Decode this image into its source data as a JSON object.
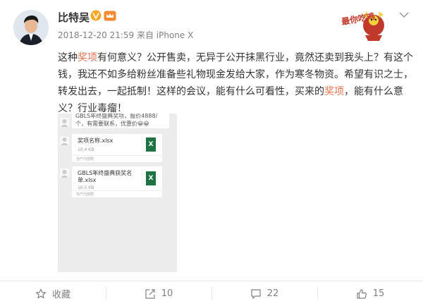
{
  "post": {
    "username": "比特吴",
    "meta": "2018-12-20 21:59 来自 iPhone X",
    "sticker_text": "最你吃鸡",
    "text": {
      "p1": "这种",
      "h1": "奖项",
      "p2": "有何意义？公开售卖，无异于公开抹黑行业，竟然还卖到我头上？有这个钱，我还不如多给粉丝准备些礼物现金发给大家，作为寒冬物资。希望有识之士，转发出去，一起抵制！这样的会议，能有什么可看性，买来的",
      "h2": "奖项",
      "p3": "，能有什么意义？行业毒瘤！"
    }
  },
  "screenshot": {
    "msg1_line1": "GBLS年终盛典奖项，报价4888/",
    "msg1_line2": "个，有需要联系，优惠价😀😀",
    "file1_name": "奖项名称.xlsx",
    "file1_size": "10.4 KB",
    "file1_foot": "自产内部群",
    "file2_name_1": "GBLS年终盛典获奖名",
    "file2_name_2": "单.xlsx",
    "file2_size": "16.5 KB",
    "file2_foot": "自产内部群",
    "xl_glyph": "X"
  },
  "actions": {
    "favorite": "收藏",
    "repost": "10",
    "comment": "22",
    "like": "15"
  },
  "colors": {
    "highlight": "#eb7350",
    "meta": "#808080",
    "excel": "#1f7244"
  }
}
